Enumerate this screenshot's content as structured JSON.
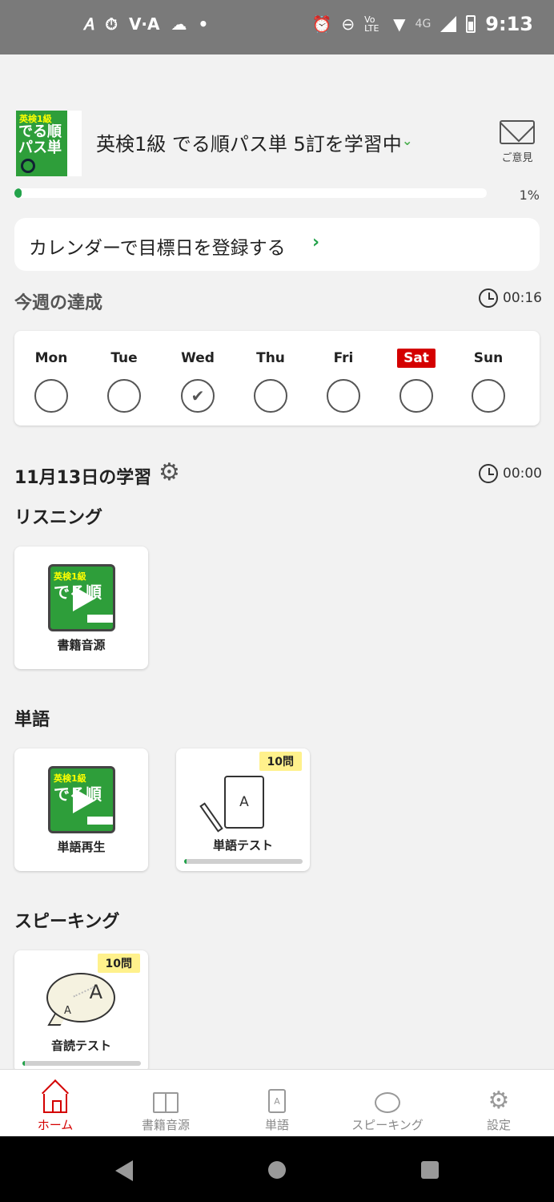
{
  "status_bar": {
    "time": "9:13",
    "left_icons": [
      "a-icon",
      "timer-icon",
      "vpn-icon",
      "cloud-icon",
      "dot-icon"
    ],
    "right_icons": [
      "alarm-icon",
      "dnd-icon",
      "volte-icon",
      "wifi-icon",
      "signal-icon",
      "battery-icon"
    ],
    "volte": "Vo LTE",
    "network": "4G"
  },
  "header": {
    "book_cover_text": [
      "英検1級",
      "でる順",
      "パス単"
    ],
    "book_title": "英検1級 でる順パス単 5訂を学習中",
    "feedback_label": "ご意見",
    "progress_percent": 1,
    "progress_label": "1%"
  },
  "calendar_link": {
    "label": "カレンダーで目標日を登録する"
  },
  "week": {
    "title": "今週の達成",
    "time": "00:16",
    "days": [
      {
        "label": "Mon",
        "done": false,
        "highlight": false
      },
      {
        "label": "Tue",
        "done": false,
        "highlight": false
      },
      {
        "label": "Wed",
        "done": true,
        "highlight": false
      },
      {
        "label": "Thu",
        "done": false,
        "highlight": false
      },
      {
        "label": "Fri",
        "done": false,
        "highlight": false
      },
      {
        "label": "Sat",
        "done": false,
        "highlight": true
      },
      {
        "label": "Sun",
        "done": false,
        "highlight": false
      }
    ]
  },
  "today": {
    "title": "11月13日の学習",
    "time": "00:00"
  },
  "sections": {
    "listening": {
      "title": "リスニング",
      "tiles": [
        {
          "label": "書籍音源"
        }
      ]
    },
    "words": {
      "title": "単語",
      "tiles": [
        {
          "label": "単語再生"
        },
        {
          "label": "単語テスト",
          "badge": "10問",
          "progress": 0.02,
          "card_letter": "A"
        }
      ]
    },
    "speaking": {
      "title": "スピーキング",
      "tiles": [
        {
          "label": "音読テスト",
          "badge": "10問",
          "progress": 0.02,
          "big_letter": "A",
          "small_letter": "A"
        }
      ]
    }
  },
  "bottom_nav": {
    "items": [
      {
        "label": "ホーム",
        "icon": "home-icon",
        "active": true
      },
      {
        "label": "書籍音源",
        "icon": "book-icon",
        "active": false
      },
      {
        "label": "単語",
        "icon": "card-icon",
        "active": false,
        "icon_letter": "A"
      },
      {
        "label": "スピーキング",
        "icon": "speech-bubble-icon",
        "active": false
      },
      {
        "label": "設定",
        "icon": "gear-icon",
        "active": false
      }
    ]
  },
  "colors": {
    "accent_green": "#22a24a",
    "active_red": "#d40000",
    "badge_yellow": "#fff18c",
    "background": "#f2f2f2"
  }
}
